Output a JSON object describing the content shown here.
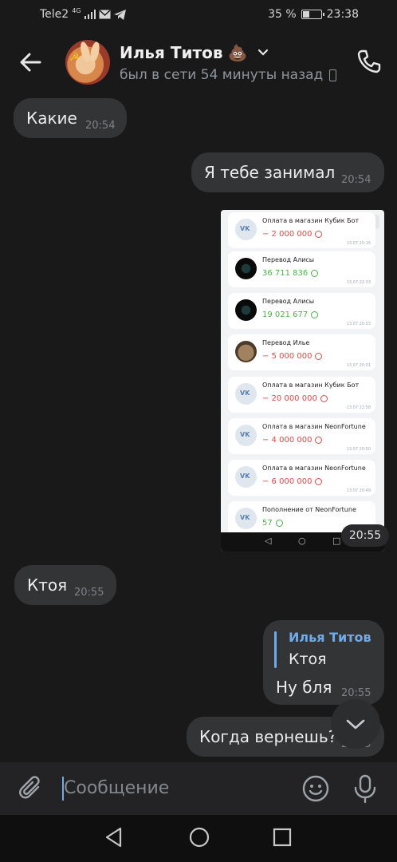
{
  "status": {
    "carrier": "Tele2",
    "net": "4G",
    "battery": "35 %",
    "time": "23:38"
  },
  "header": {
    "name": "Илья Титов",
    "emoji": "💩",
    "last_seen": "был в сети 54 минуты назад"
  },
  "messages": [
    {
      "side": "in",
      "text": "Какие",
      "time": "20:54"
    },
    {
      "side": "out",
      "text": "Я тебе занимал",
      "time": "20:54"
    },
    {
      "side": "out",
      "type": "image",
      "time": "20:55"
    },
    {
      "side": "in",
      "text": "Ктоя",
      "time": "20:55"
    },
    {
      "side": "out",
      "reply_name": "Илья Титов",
      "reply_text": "Ктоя",
      "text": "Ну бля",
      "time": "20:55"
    },
    {
      "side": "out",
      "text": "Когда вернешь?",
      "time": "20:55"
    }
  ],
  "screenshot": {
    "close": "✕",
    "transactions": [
      {
        "title": "Оплата в магазин Кубик Бот",
        "amount": "− 2 000 000",
        "kind": "neg",
        "icon": "vk-icon",
        "meta": "13.07 20:15"
      },
      {
        "title": "Перевод Алисы",
        "amount": "36 711 836",
        "kind": "pos",
        "icon": "dark-avatar",
        "meta": "13.07 22:03"
      },
      {
        "title": "Перевод Алисы",
        "amount": "19 021 677",
        "kind": "pos",
        "icon": "dark-avatar",
        "meta": "13.07 20:03"
      },
      {
        "title": "Перевод Илье",
        "amount": "− 5 000 000",
        "kind": "neg",
        "icon": "bear-avatar",
        "meta": "13.07 20:01"
      },
      {
        "title": "Оплата в магазин Кубик Бот",
        "amount": "− 20 000 000",
        "kind": "neg",
        "icon": "vk-icon",
        "meta": "13.07 22:58"
      },
      {
        "title": "Оплата в магазин NeonFortune",
        "amount": "− 4 000 000",
        "kind": "neg",
        "icon": "vk-icon",
        "meta": "13.07 20:50"
      },
      {
        "title": "Оплата в магазин NeonFortune",
        "amount": "− 6 000 000",
        "kind": "neg",
        "icon": "vk-icon",
        "meta": "13.07 20:49"
      },
      {
        "title": "Пополнение от NeonFortune",
        "amount": "57",
        "kind": "pos",
        "icon": "vk-icon",
        "meta": ""
      }
    ]
  },
  "composer": {
    "placeholder": "Сообщение"
  },
  "colors": {
    "bg": "#19191a",
    "bubble": "#333436",
    "accent": "#71aaeb"
  }
}
